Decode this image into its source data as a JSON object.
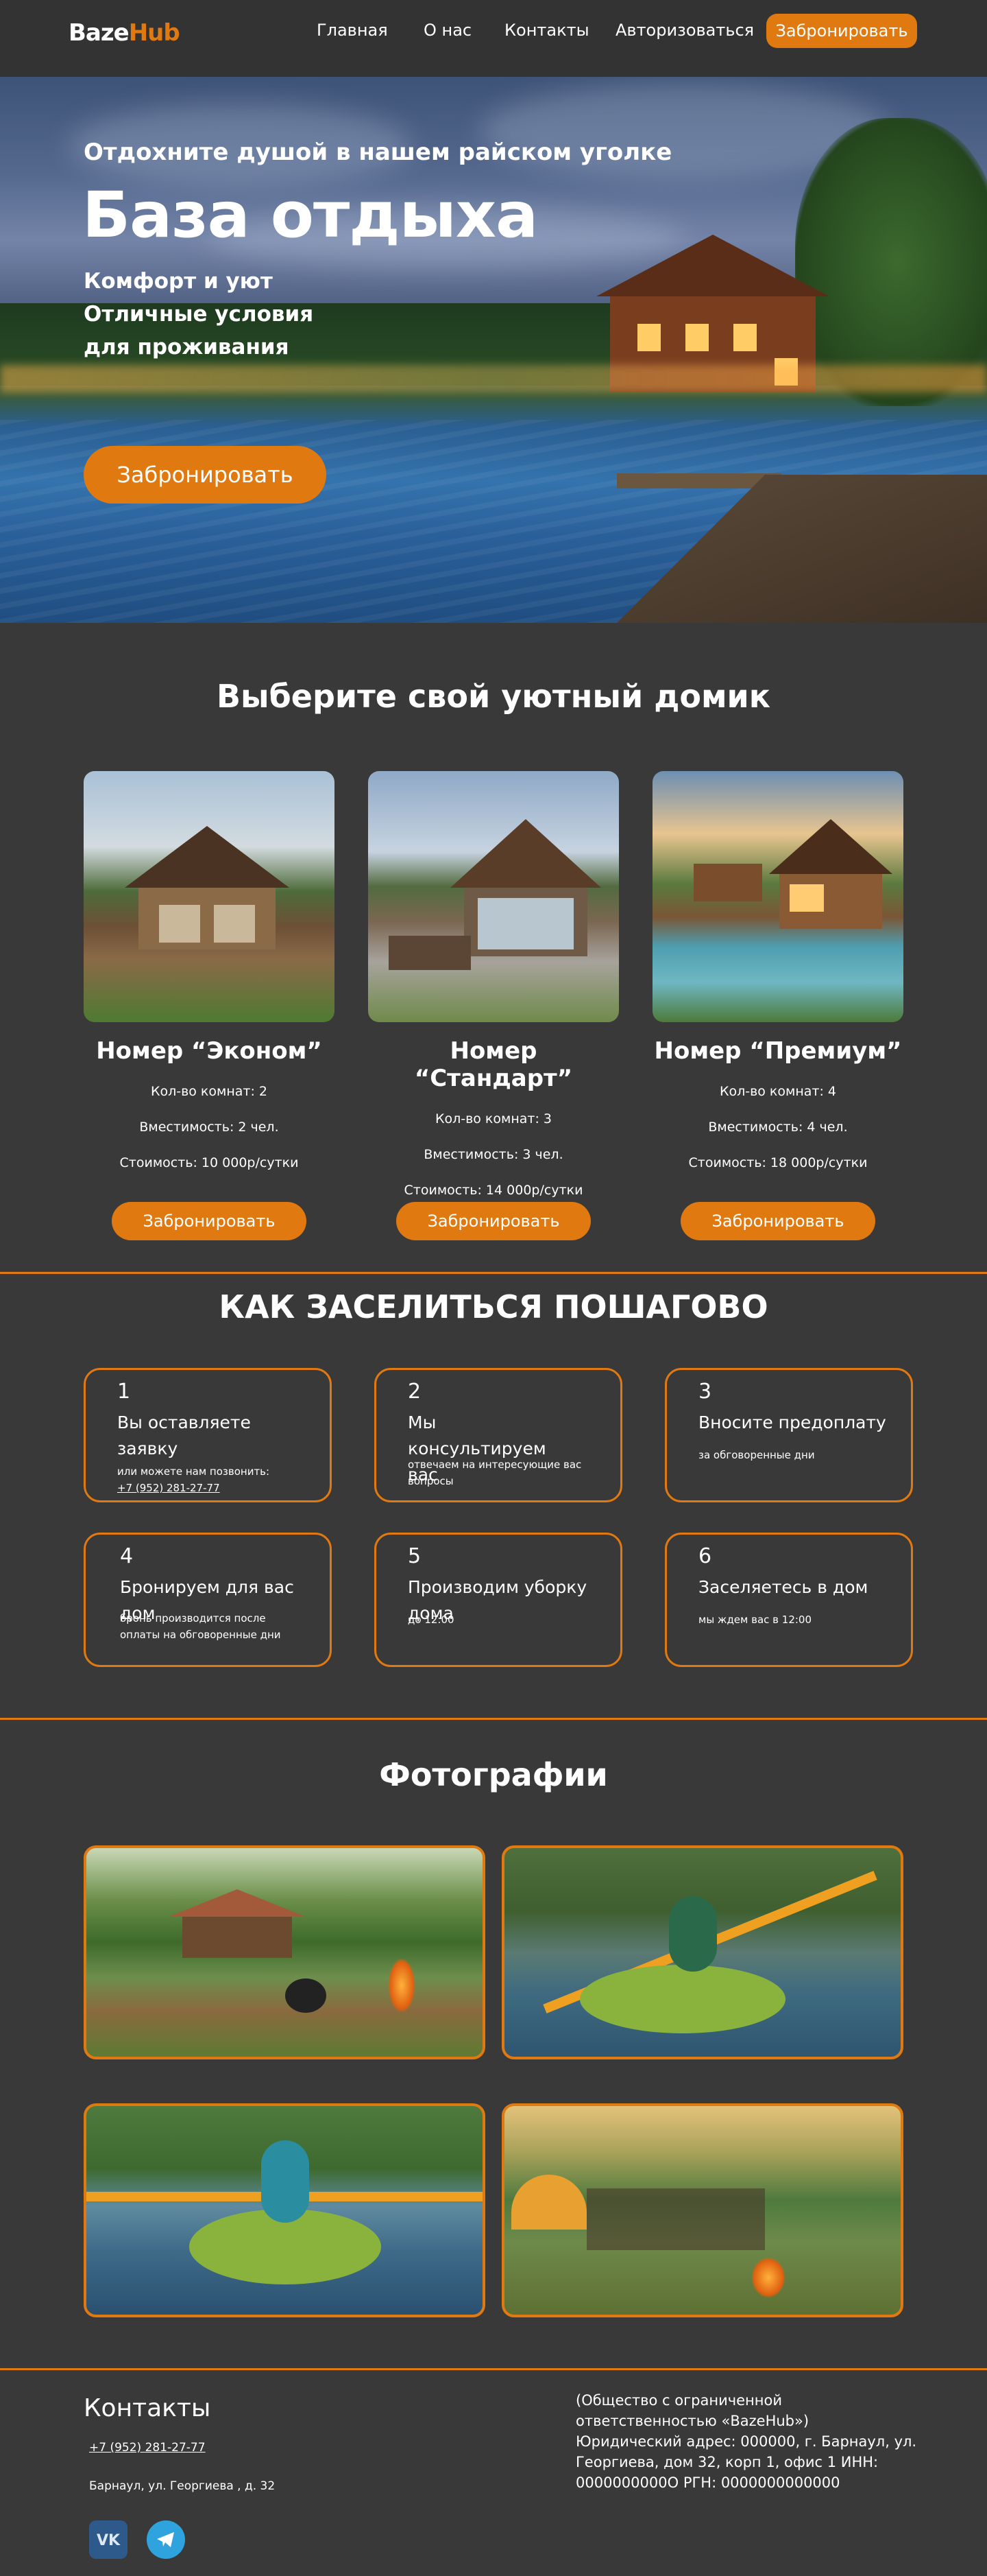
{
  "colors": {
    "accent": "#e07a10",
    "background": "#393939",
    "header": "#333333"
  },
  "header": {
    "logo_part1": "Baze",
    "logo_part2": "Hub",
    "nav": [
      "Главная",
      "О нас",
      "Контакты",
      "Авторизоваться"
    ],
    "book_label": "Забронировать"
  },
  "hero": {
    "subtitle": "Отдохните душой в нашем райском уголке",
    "title": "База отдыха",
    "lines": [
      "Комфорт и уют",
      "Отличные условия",
      "для проживания"
    ],
    "book_label": "Забронировать"
  },
  "cabins": {
    "title": "Выберите свой уютный домик",
    "items": [
      {
        "name": "Номер “Эконом”",
        "rooms": "Кол-во комнат: 2",
        "capacity": "Вместимость: 2 чел.",
        "price": "Стоимость: 10 000р/сутки",
        "book_label": "Забронировать"
      },
      {
        "name": "Номер “Стандарт”",
        "rooms": "Кол-во комнат: 3",
        "capacity": "Вместимость: 3 чел.",
        "price": "Стоимость: 14 000р/сутки",
        "book_label": "Забронировать"
      },
      {
        "name": "Номер “Премиум”",
        "rooms": "Кол-во комнат: 4",
        "capacity": "Вместимость: 4 чел.",
        "price": "Стоимость: 18 000р/сутки",
        "book_label": "Забронировать"
      }
    ]
  },
  "steps": {
    "title": "КАК ЗАСЕЛИТЬСЯ ПОШАГОВО",
    "items": [
      {
        "num": "1",
        "title": "Вы оставляете заявку",
        "desc": "или можете нам позвонить:",
        "phone": "+7 (952) 281-27-77"
      },
      {
        "num": "2",
        "title": "Мы консультируем вас",
        "desc": "отвечаем на интересующие вас вопросы"
      },
      {
        "num": "3",
        "title": "Вносите предоплату",
        "desc": "за обговоренные дни"
      },
      {
        "num": "4",
        "title": "Бронируем для вас дом",
        "desc": "бронь производится после оплаты на обговоренные дни"
      },
      {
        "num": "5",
        "title": "Производим уборку дома",
        "desc": "до 12:00"
      },
      {
        "num": "6",
        "title": "Заселяетесь в дом",
        "desc": "мы ждем вас в 12:00"
      }
    ]
  },
  "photos": {
    "title": "Фотографии"
  },
  "footer": {
    "title": "Контакты",
    "phone": "+7 (952) 281-27-77",
    "address": "Барнаул, ул. Георгиева , д. 32",
    "legal": "(Общество с ограниченной ответственностью «BazeHub») Юридический адрес: 000000, г. Барнаул, ул. Георгиева, дом 32, корп 1, офис 1 ИНН: 0000000000О РГН: 0000000000000",
    "social": [
      "vk-icon",
      "telegram-icon"
    ]
  }
}
